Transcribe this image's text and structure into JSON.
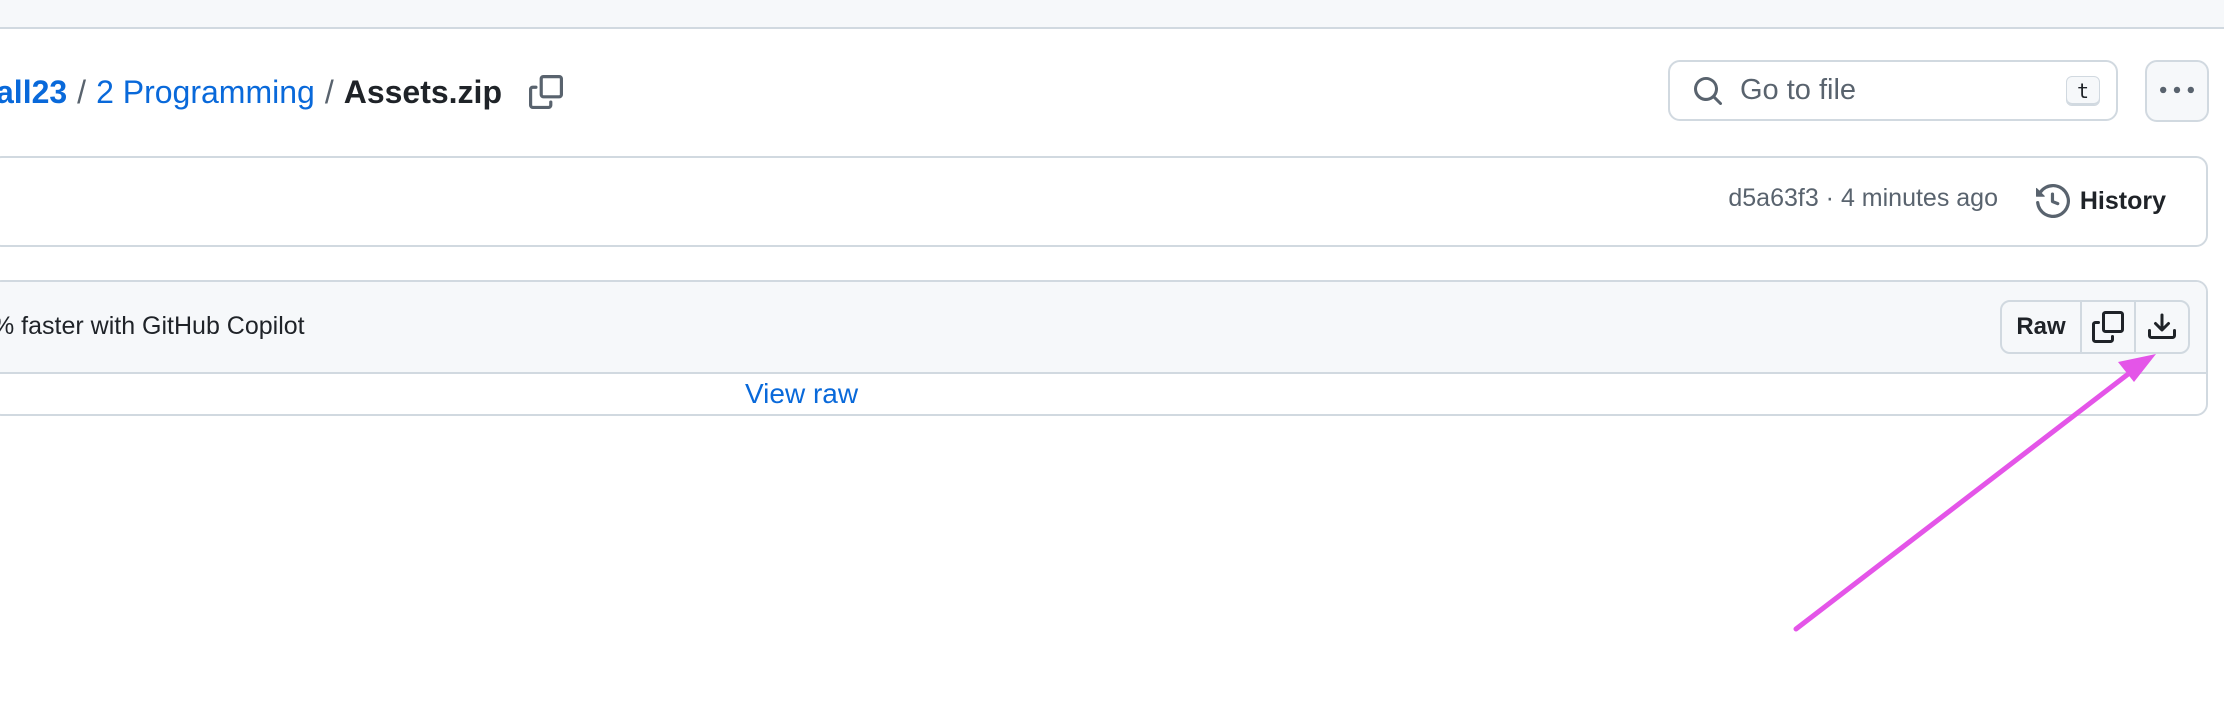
{
  "breadcrumb": {
    "items": [
      {
        "label": "all23"
      },
      {
        "label": "2 Programming"
      }
    ],
    "separator": "/",
    "current": "Assets.zip"
  },
  "search": {
    "placeholder": "Go to file",
    "shortcut": "t"
  },
  "commit": {
    "meta": "d5a63f3 · 4 minutes ago",
    "history_label": "History"
  },
  "file": {
    "copilot_text": "% faster with GitHub Copilot",
    "raw_label": "Raw",
    "view_raw_label": "View raw"
  },
  "colors": {
    "link": "#0969da",
    "border": "#d1d9e0",
    "header_bg": "#f6f8fa",
    "annotation_arrow": "#e455e8"
  },
  "icons": [
    "copy-icon",
    "search-icon",
    "kebab-icon",
    "history-icon",
    "download-icon"
  ]
}
